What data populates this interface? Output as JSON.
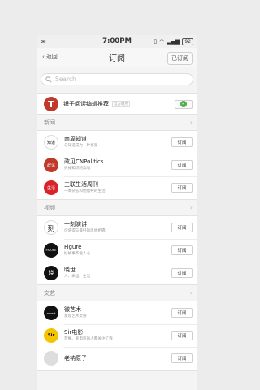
{
  "status_bar": {
    "time": "7:00PM",
    "battery": "92"
  },
  "header": {
    "back_label": "返回",
    "title": "订阅",
    "right_button": "已订阅"
  },
  "search": {
    "placeholder": "Search"
  },
  "featured": {
    "name": "锤子阅读编辑推荐",
    "tag": "官方站点"
  },
  "sections": [
    {
      "title": "新闻",
      "items": [
        {
          "name": "南周知道",
          "desc": "与知道成为一种享受",
          "button": "订阅",
          "avatar_text": "知道",
          "avatar_color": "#ffffff"
        },
        {
          "name": "政见CNPolitics",
          "desc": "拆掉知识的高墙",
          "button": "订阅",
          "avatar_text": "政见",
          "avatar_color": "#c0392b"
        },
        {
          "name": "三联生活周刊",
          "desc": "一本杂志和他倡导的生活",
          "button": "订阅",
          "avatar_text": "生活",
          "avatar_color": "#d8232a"
        }
      ]
    },
    {
      "title": "视频",
      "items": [
        {
          "name": "一刻演讲",
          "desc": "价值得与最好的思想相遇",
          "button": "订阅",
          "avatar_text": "刻",
          "avatar_color": "#ffffff"
        },
        {
          "name": "Figure",
          "desc": "好故事不语人心",
          "button": "订阅",
          "avatar_text": "FIGURE",
          "avatar_color": "#111111"
        },
        {
          "name": "晓世",
          "desc": "人、命运、生活",
          "button": "订阅",
          "avatar_text": "晓",
          "avatar_color": "#111111"
        }
      ]
    },
    {
      "title": "文艺",
      "items": [
        {
          "name": "微艺术",
          "desc": "发现艺术灵感",
          "button": "订阅",
          "avatar_text": "weart",
          "avatar_color": "#111111"
        },
        {
          "name": "Sir电影",
          "desc": "首推、爱电影的人都关注了我",
          "button": "订阅",
          "avatar_text": "Sir",
          "avatar_color": "#f5c400"
        },
        {
          "name": "老衲原子",
          "desc": "",
          "button": "订阅",
          "avatar_text": "",
          "avatar_color": "#dddddd"
        }
      ]
    }
  ],
  "colors": {
    "accent_green": "#4cae4c",
    "featured_red": "#c0392b"
  }
}
